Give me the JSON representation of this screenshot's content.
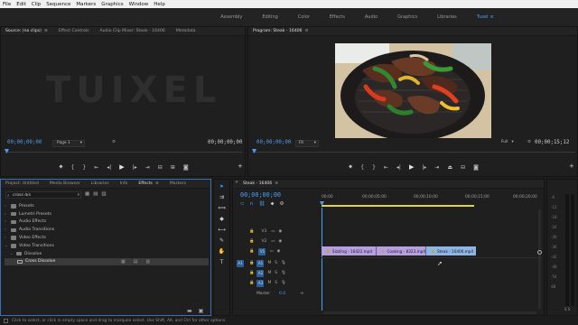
{
  "menu": [
    "File",
    "Edit",
    "Clip",
    "Sequence",
    "Markers",
    "Graphics",
    "Window",
    "Help"
  ],
  "workspaces": [
    "Assembly",
    "Editing",
    "Color",
    "Effects",
    "Audio",
    "Graphics",
    "Libraries",
    "Tuxel"
  ],
  "active_workspace": "Tuxel",
  "source": {
    "tabs": [
      "Source: (no clips)",
      "Effect Controls",
      "Audio Clip Mixer: Steak - 16406",
      "Metadata"
    ],
    "watermark": "TUIXEL",
    "tc_left": "00;00;00;00",
    "page": "Page 1",
    "tc_right": "00;00;00;00"
  },
  "program": {
    "tab": "Program: Steak - 16406",
    "tc_left": "00;00;00;00",
    "fit": "Fit",
    "quality": "Full",
    "tc_right": "00;00;15;12"
  },
  "project": {
    "tabs": [
      "Project: Untitled",
      "Media Browser",
      "Libraries",
      "Info",
      "Effects",
      "Markers"
    ],
    "search_value": "cross dis",
    "tree": [
      {
        "label": "Presets",
        "indent": 0,
        "expanded": false
      },
      {
        "label": "Lumetri Presets",
        "indent": 0,
        "expanded": false
      },
      {
        "label": "Audio Effects",
        "indent": 0,
        "expanded": false
      },
      {
        "label": "Audio Transitions",
        "indent": 0,
        "expanded": false
      },
      {
        "label": "Video Effects",
        "indent": 0,
        "expanded": false
      },
      {
        "label": "Video Transitions",
        "indent": 0,
        "expanded": true
      },
      {
        "label": "Dissolve",
        "indent": 1,
        "expanded": true
      },
      {
        "label": "Cross Dissolve",
        "indent": 2,
        "expanded": false,
        "selected": true
      }
    ]
  },
  "timeline": {
    "tab": "Steak - 16406",
    "tc": "00;00;00;00",
    "ruler": [
      "00;00",
      "00;00;05;00",
      "00;00;10;00",
      "00;00;15;00",
      "00;00;20;00"
    ],
    "video_tracks": [
      "V3",
      "V2",
      "V1"
    ],
    "audio_tracks": [
      "A1",
      "A2",
      "A3"
    ],
    "master_label": "Master",
    "master_value": "0.0",
    "clips": [
      {
        "name": "Sizzling - 16422.mp4",
        "color": "#b69fe0"
      },
      {
        "name": "Cooking - 8323.mp4",
        "color": "#b69fe0"
      },
      {
        "name": "Steak - 16406.mp4",
        "color": "#8fb4e6"
      }
    ]
  },
  "status_text": "Click to select, or click in empty space and drag to marquee select. Use Shift, Alt, and Ctrl for other options.",
  "colors": {
    "accent": "#4a9ff5",
    "clip_purple": "#b69fe0",
    "clip_blue": "#8fb4e6",
    "progress_yellow": "#e0d34a"
  }
}
